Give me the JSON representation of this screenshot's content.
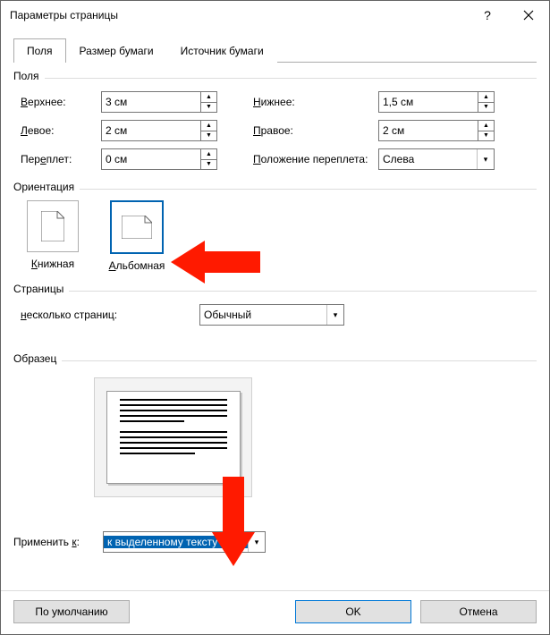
{
  "title": "Параметры страницы",
  "tabs": {
    "margins": "Поля",
    "paper_size": "Размер бумаги",
    "paper_source": "Источник бумаги"
  },
  "groups": {
    "margins": "Поля",
    "orientation": "Ориентация",
    "pages": "Страницы",
    "preview": "Образец"
  },
  "margins": {
    "top_label": "Верхнее:",
    "top_value": "3 см",
    "bottom_label": "Нижнее:",
    "bottom_mn": "Н",
    "bottom_value": "1,5 см",
    "left_label": "Левое:",
    "left_mn": "Л",
    "left_value": "2 см",
    "right_label": "Правое:",
    "right_mn": "П",
    "right_value": "2 см",
    "gutter_label": "Переплет:",
    "gutter_mn": "е",
    "gutter_value": "0 см",
    "gutter_pos_label": "Положение переплета:",
    "gutter_pos_mn": "П",
    "gutter_pos_value": "Слева"
  },
  "orientation": {
    "portrait": "Книжная",
    "portrait_mn": "К",
    "landscape": "Альбомная",
    "landscape_mn": "А"
  },
  "pages": {
    "multi_label": "несколько страниц:",
    "multi_mn": "н",
    "multi_value": "Обычный"
  },
  "apply": {
    "label": "Применить к:",
    "mn": "к",
    "value": "к выделенному тексту"
  },
  "buttons": {
    "default": "По умолчанию",
    "ok": "OK",
    "cancel": "Отмена"
  }
}
